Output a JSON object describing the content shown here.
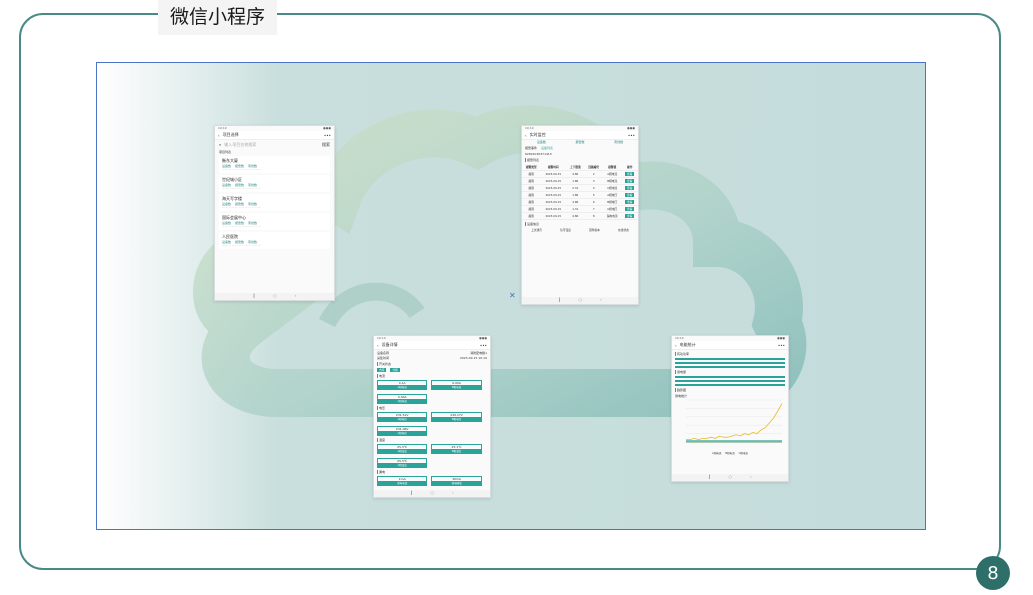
{
  "frame": {
    "title": "微信小程序",
    "page_number": "8"
  },
  "colors": {
    "accent": "#2aa39b",
    "frame_border": "#4a8a86",
    "badge": "#2f6f6a",
    "slide_border": "#4a73c9"
  },
  "phone1": {
    "title": "项目选择",
    "search_placeholder": "输入项目名称搜索",
    "search_button": "搜索",
    "list_header": "项目列表",
    "items": [
      {
        "name": "衡东大厦",
        "tags": [
          "设备数",
          "报警数",
          "离线数"
        ]
      },
      {
        "name": "世纪城小区",
        "tags": [
          "设备数",
          "报警数",
          "离线数"
        ]
      },
      {
        "name": "海天写字楼",
        "tags": [
          "设备数",
          "报警数",
          "离线数"
        ]
      },
      {
        "name": "国际会展中心",
        "tags": [
          "设备数",
          "报警数",
          "离线数"
        ]
      },
      {
        "name": "人民医院",
        "tags": [
          "设备数",
          "报警数",
          "离线数"
        ]
      }
    ]
  },
  "phone2": {
    "title": "实时监控",
    "summary": [
      "设备数",
      "报警数",
      "离线数"
    ],
    "tabs": [
      "报警事件",
      "设备列表"
    ],
    "device_id": "62841030371415",
    "section1": "报警列表",
    "table_headers": [
      "报警类型",
      "报警时间",
      "上下限值",
      "回路编号",
      "报警值",
      "操作"
    ],
    "rows": [
      {
        "type": "越限",
        "time": "2023-09-15",
        "limit": "4.86",
        "loop": "2",
        "value": "A相电流",
        "action": "查看"
      },
      {
        "type": "越限",
        "time": "2023-09-15",
        "limit": "1.86",
        "loop": "3",
        "value": "B相电流",
        "action": "查看"
      },
      {
        "type": "越限",
        "time": "2023-09-15",
        "limit": "2.31",
        "loop": "4",
        "value": "C相电流",
        "action": "查看"
      },
      {
        "type": "越限",
        "time": "2023-09-15",
        "limit": "1.86",
        "loop": "5",
        "value": "A相电压",
        "action": "查看"
      },
      {
        "type": "越限",
        "time": "2023-09-15",
        "limit": "4.86",
        "loop": "6",
        "value": "B相电压",
        "action": "查看"
      },
      {
        "type": "越限",
        "time": "2023-09-15",
        "limit": "1.31",
        "loop": "7",
        "value": "C相电压",
        "action": "查看"
      },
      {
        "type": "越限",
        "time": "2023-09-15",
        "limit": "4.86",
        "loop": "8",
        "value": "漏电电流",
        "action": "查看"
      }
    ],
    "section2": "设备信息",
    "footer_cols": [
      "上次通讯",
      "信号强度",
      "固件版本",
      "在线状态"
    ]
  },
  "phone3": {
    "title": "设备详情",
    "fields": [
      {
        "label": "设备名称",
        "value": "消防配电箱1"
      },
      {
        "label": "采集时间",
        "value": "2023-09-15 10:10"
      }
    ],
    "switch_label": "开关状态",
    "switches": [
      "合闸",
      "分闸"
    ],
    "section_current": "电流",
    "current": [
      {
        "v": "0.1A",
        "k": "A相电流"
      },
      {
        "v": "0.00A",
        "k": "B相电流"
      },
      {
        "v": "0.00A",
        "k": "C相电流"
      }
    ],
    "section_voltage": "电压",
    "voltage": [
      {
        "v": "231.51V",
        "k": "A相电压"
      },
      {
        "v": "230.17V",
        "k": "B相电压"
      },
      {
        "v": "231.06V",
        "k": "C相电压"
      }
    ],
    "section_temp": "温度",
    "temp": [
      {
        "v": "25.3℃",
        "k": "A相温度"
      },
      {
        "v": "25.1℃",
        "k": "B相温度"
      },
      {
        "v": "25.3℃",
        "k": "C相温度"
      }
    ],
    "section_leak": "漏电",
    "leak": [
      {
        "v": "1mA",
        "k": "漏电电流"
      },
      {
        "v": "30mA",
        "k": "漏电阈值"
      }
    ]
  },
  "phone4": {
    "title": "电能统计",
    "section_power": "有功功率",
    "section_energy": "用电量",
    "section_chart": "趋势图",
    "chart_label": "用电统计",
    "legend": [
      "A相电流",
      "B相电流",
      "C相电流"
    ],
    "chart_data": {
      "type": "line",
      "x": [
        1,
        2,
        3,
        4,
        5,
        6,
        7,
        8,
        9,
        10,
        11,
        12,
        13,
        14,
        15,
        16,
        17,
        18,
        19,
        20,
        21,
        22,
        23,
        24
      ],
      "series": [
        {
          "name": "A相电流",
          "values": [
            0.2,
            0.2,
            0.3,
            0.2,
            0.3,
            0.3,
            0.4,
            0.3,
            0.5,
            0.4,
            0.4,
            0.5,
            0.6,
            0.5,
            0.7,
            0.6,
            0.8,
            0.7,
            1.0,
            1.2,
            1.6,
            2.0,
            2.6,
            3.2
          ]
        },
        {
          "name": "B相电流",
          "values": [
            0.1,
            0.1,
            0.1,
            0.1,
            0.1,
            0.1,
            0.1,
            0.1,
            0.1,
            0.1,
            0.1,
            0.1,
            0.1,
            0.1,
            0.1,
            0.1,
            0.1,
            0.1,
            0.1,
            0.1,
            0.1,
            0.1,
            0.1,
            0.1
          ]
        },
        {
          "name": "C相电流",
          "values": [
            0,
            0,
            0,
            0,
            0,
            0,
            0,
            0,
            0,
            0,
            0,
            0,
            0,
            0,
            0,
            0,
            0,
            0,
            0,
            0,
            0,
            0,
            0,
            0
          ]
        }
      ],
      "ylim": [
        0,
        3.5
      ]
    }
  }
}
